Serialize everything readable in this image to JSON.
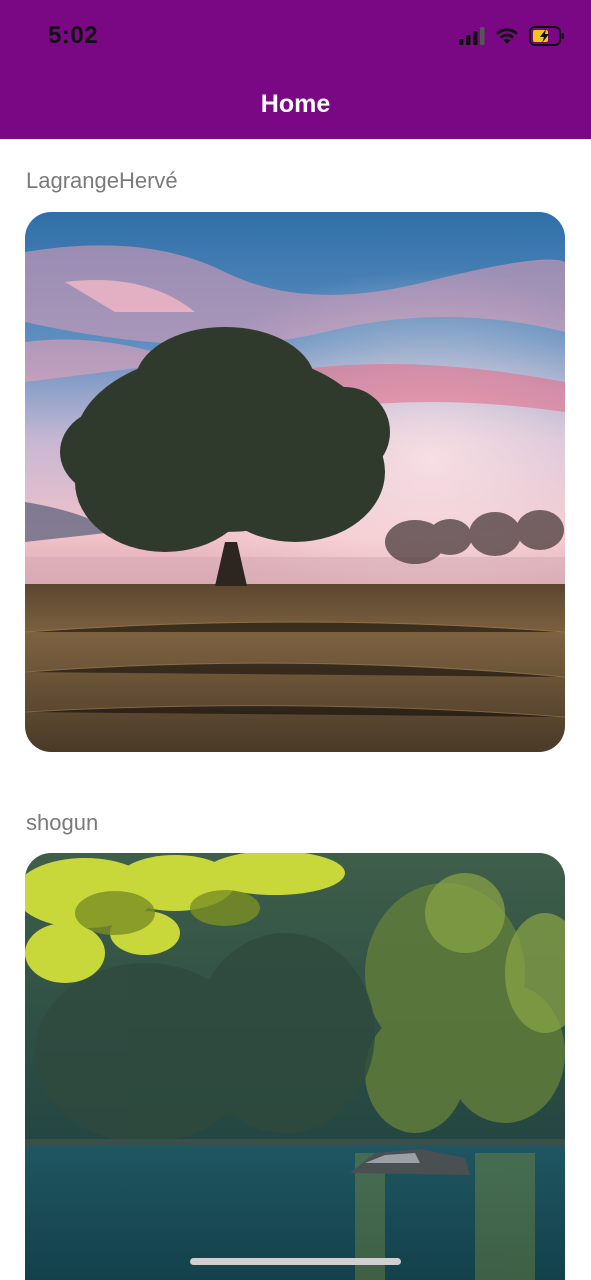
{
  "status_bar": {
    "time": "5:02",
    "icons": [
      "cellular-signal-icon",
      "wifi-icon",
      "battery-charging-icon"
    ]
  },
  "header": {
    "title": "Home",
    "background_color": "#7a0784"
  },
  "posts": [
    {
      "author": "LagrangeHervé",
      "image_subject": "lone tree in grass field at sunrise with pink clouds"
    },
    {
      "author": "shogun",
      "image_subject": "forest lake with rock and autumn leaves"
    }
  ]
}
